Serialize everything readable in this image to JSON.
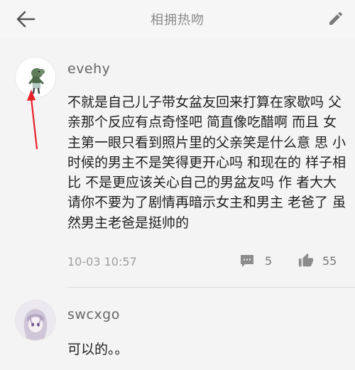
{
  "header": {
    "title": "相拥热吻",
    "back_icon": "arrow-left-icon",
    "edit_icon": "pencil-icon"
  },
  "comments": [
    {
      "username": "evehy",
      "avatar_icon": "dinosaur-avatar",
      "content": "不就是自己儿子带女盆友回来打算在家歇吗 父亲那个反应有点奇怪吧 简直像吃醋啊 而且 女主第一眼只看到照片里的父亲笑是什么意 思 小时候的男主不是笑得更开心吗 和现在的 样子相比 不是更应该关心自己的男盆友吗 作 者大大请你不要为了剧情再暗示女主和男主 老爸了 虽然男主老爸是挺帅的",
      "timestamp": "10-03 10:57",
      "reply_count": "5",
      "like_count": "55"
    },
    {
      "username": "swcxgo",
      "avatar_icon": "anime-girl-avatar",
      "content": "可以的。。"
    }
  ],
  "colors": {
    "annotation_arrow": "#e8202a",
    "icon_gray": "#8c8c8c"
  }
}
